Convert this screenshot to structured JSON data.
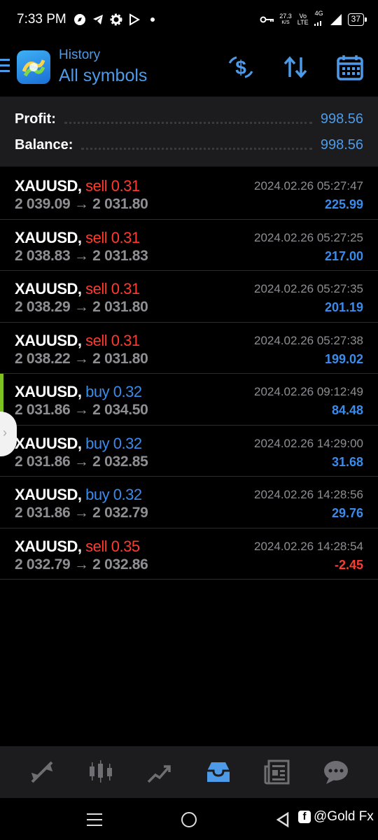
{
  "status_bar": {
    "time": "7:33 PM",
    "speed_value": "27.3",
    "speed_unit": "K/S",
    "volte_top": "Vo",
    "volte_bottom": "LTE",
    "network": "4G",
    "battery": "37"
  },
  "header": {
    "subtitle": "History",
    "title": "All symbols"
  },
  "summary": {
    "profit_label": "Profit:",
    "profit_value": "998.56",
    "balance_label": "Balance:",
    "balance_value": "998.56"
  },
  "trades": [
    {
      "symbol": "XAUUSD,",
      "direction": "sell",
      "volume": "0.31",
      "open_price": "2 039.09",
      "arrow": "→",
      "close_price": "2 031.80",
      "datetime": "2024.02.26 05:27:47",
      "profit": "225.99"
    },
    {
      "symbol": "XAUUSD,",
      "direction": "sell",
      "volume": "0.31",
      "open_price": "2 038.83",
      "arrow": "→",
      "close_price": "2 031.83",
      "datetime": "2024.02.26 05:27:25",
      "profit": "217.00"
    },
    {
      "symbol": "XAUUSD,",
      "direction": "sell",
      "volume": "0.31",
      "open_price": "2 038.29",
      "arrow": "→",
      "close_price": "2 031.80",
      "datetime": "2024.02.26 05:27:35",
      "profit": "201.19"
    },
    {
      "symbol": "XAUUSD,",
      "direction": "sell",
      "volume": "0.31",
      "open_price": "2 038.22",
      "arrow": "→",
      "close_price": "2 031.80",
      "datetime": "2024.02.26 05:27:38",
      "profit": "199.02"
    },
    {
      "symbol": "XAUUSD,",
      "direction": "buy",
      "volume": "0.32",
      "open_price": "2 031.86",
      "arrow": "→",
      "close_price": "2 034.50",
      "datetime": "2024.02.26 09:12:49",
      "profit": "84.48"
    },
    {
      "symbol": "XAUUSD,",
      "direction": "buy",
      "volume": "0.32",
      "open_price": "2 031.86",
      "arrow": "→",
      "close_price": "2 032.85",
      "datetime": "2024.02.26 14:29:00",
      "profit": "31.68"
    },
    {
      "symbol": "XAUUSD,",
      "direction": "buy",
      "volume": "0.32",
      "open_price": "2 031.86",
      "arrow": "→",
      "close_price": "2 032.79",
      "datetime": "2024.02.26 14:28:56",
      "profit": "29.76"
    },
    {
      "symbol": "XAUUSD,",
      "direction": "sell",
      "volume": "0.35",
      "open_price": "2 032.79",
      "arrow": "→",
      "close_price": "2 032.86",
      "datetime": "2024.02.26 14:28:54",
      "profit": "-2.45"
    }
  ],
  "tabs": [
    {
      "icon": "quotes-icon"
    },
    {
      "icon": "chart-icon"
    },
    {
      "icon": "trade-icon"
    },
    {
      "icon": "history-icon",
      "active": true
    },
    {
      "icon": "news-icon"
    },
    {
      "icon": "chat-icon"
    }
  ],
  "watermark": {
    "text": "@Gold Fx"
  },
  "colors": {
    "accent": "#4d9be8",
    "sell": "#ff3b30",
    "buy": "#3b8beb",
    "muted": "#8e8e93"
  }
}
